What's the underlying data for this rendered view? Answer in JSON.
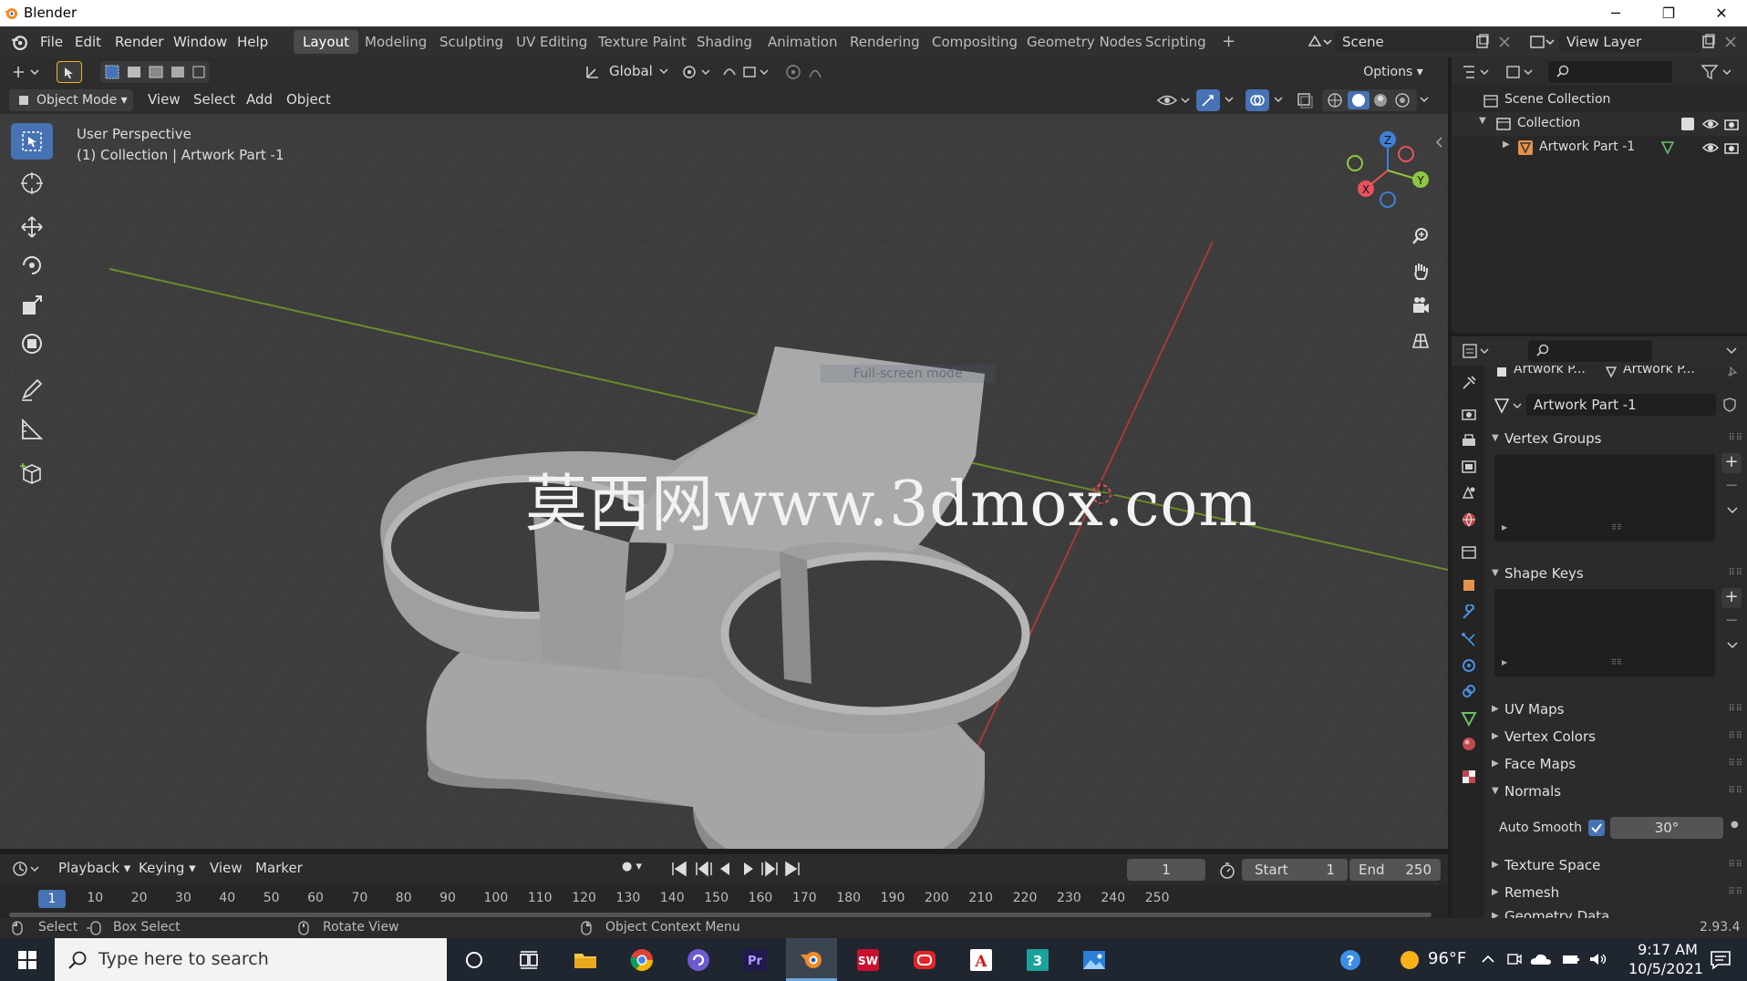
{
  "window": {
    "title": "Blender",
    "minimize": "─",
    "maximize": "❐",
    "close": "✕"
  },
  "menu": [
    "File",
    "Edit",
    "Render",
    "Window",
    "Help"
  ],
  "workspaces": [
    "Layout",
    "Modeling",
    "Sculpting",
    "UV Editing",
    "Texture Paint",
    "Shading",
    "Animation",
    "Rendering",
    "Compositing",
    "Geometry Nodes",
    "Scripting"
  ],
  "active_workspace": "Layout",
  "add_workspace": "+",
  "scene": {
    "name": "Scene"
  },
  "view_layer": {
    "name": "View Layer"
  },
  "viewport_header": {
    "transform_orientation": "Global",
    "options": "Options",
    "mode": "Object Mode",
    "menus": [
      "View",
      "Select",
      "Add",
      "Object"
    ]
  },
  "viewport": {
    "info_line1": "User Perspective",
    "info_line2": "(1) Collection | Artwork Part -1",
    "watermark": "莫西网www.3dmox.com",
    "tooltip_faded": "Full-screen mode"
  },
  "gizmo": {
    "x": "X",
    "y": "Y",
    "z": "Z"
  },
  "outliner": {
    "scene_collection": "Scene Collection",
    "collection": "Collection",
    "object": "Artwork Part -1"
  },
  "properties": {
    "breadcrumb_object": "Artwork P...",
    "breadcrumb_data": "Artwork P...",
    "mesh_name": "Artwork Part -1",
    "panels": {
      "vertex_groups": "Vertex Groups",
      "shape_keys": "Shape Keys",
      "uv_maps": "UV Maps",
      "vertex_colors": "Vertex Colors",
      "face_maps": "Face Maps",
      "normals": "Normals",
      "texture_space": "Texture Space",
      "remesh": "Remesh",
      "geometry_data": "Geometry Data"
    },
    "auto_smooth_label": "Auto Smooth",
    "auto_smooth_checked": true,
    "auto_smooth_angle": "30°"
  },
  "timeline": {
    "menus": [
      "Playback",
      "Keying",
      "View",
      "Marker"
    ],
    "current_frame": "1",
    "start_label": "Start",
    "start": "1",
    "end_label": "End",
    "end": "250",
    "ruler": [
      "1",
      "10",
      "20",
      "30",
      "40",
      "50",
      "60",
      "70",
      "80",
      "90",
      "100",
      "110",
      "120",
      "130",
      "140",
      "150",
      "160",
      "170",
      "180",
      "190",
      "200",
      "210",
      "220",
      "230",
      "240",
      "250"
    ]
  },
  "status_bar": {
    "select": "Select",
    "box_select": "Box Select",
    "rotate_view": "Rotate View",
    "context_menu": "Object Context Menu",
    "version": "2.93.4"
  },
  "taskbar": {
    "search_placeholder": "Type here to search",
    "weather": "96°F",
    "time": "9:17 AM",
    "date": "10/5/2021"
  },
  "colors": {
    "accent": "#4772b3",
    "x_axis": "#e8525c",
    "y_axis": "#8fc640",
    "z_axis": "#3f80d9"
  }
}
